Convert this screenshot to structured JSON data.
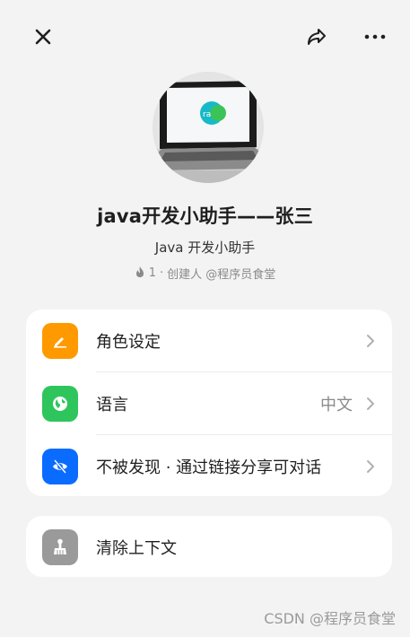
{
  "header": {
    "close_icon": "close-icon",
    "share_icon": "share-icon",
    "more_icon": "more-icon"
  },
  "profile": {
    "title": "java开发小助手——张三",
    "subtitle": "Java 开发小助手",
    "popularity_count": "1",
    "creator": "创建人 @程序员食堂"
  },
  "settings": [
    {
      "label": "角色设定",
      "value": "",
      "icon": "pencil-icon",
      "color": "#ff9900"
    },
    {
      "label": "语言",
      "value": "中文",
      "icon": "globe-icon",
      "color": "#2ec55d"
    },
    {
      "label": "不被发现 · 通过链接分享可对话",
      "value": "",
      "icon": "eye-off-icon",
      "color": "#0a6cff"
    }
  ],
  "actions": [
    {
      "label": "清除上下文",
      "icon": "broom-icon",
      "color": "#9a9a9a"
    }
  ],
  "watermark": "CSDN @程序员食堂"
}
